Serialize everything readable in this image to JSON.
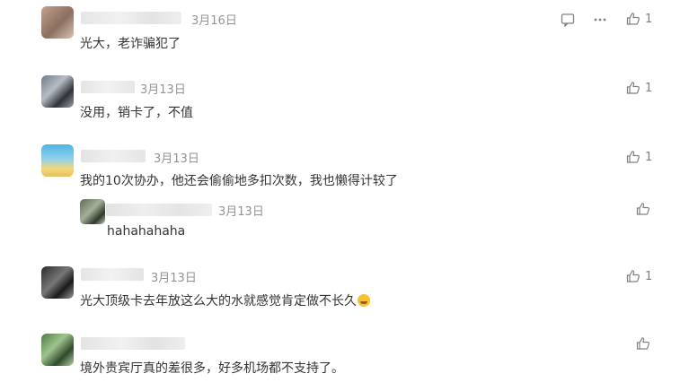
{
  "comments": [
    {
      "date": "3月16日",
      "text": "光大，老诈骗犯了",
      "likes": "1"
    },
    {
      "date": "3月13日",
      "text": "没用，销卡了，不值",
      "likes": "1"
    },
    {
      "date": "3月13日",
      "text": "我的10次协办，他还会偷偷地多扣次数，我也懒得计较了",
      "likes": "1"
    },
    {
      "date": "3月13日",
      "text": "hahahahaha",
      "likes": ""
    },
    {
      "date": "3月13日",
      "text": "光大顶级卡去年放这么大的水就感觉肯定做不长久",
      "likes": "1"
    },
    {
      "date": "",
      "text": "境外贵宾厅真的差很多，好多机场都不支持了。",
      "likes": ""
    }
  ],
  "icons": {
    "reply": "comment-icon",
    "more": "more-icon",
    "like": "thumbs-up-icon",
    "emoji": "facepalm-emoji"
  }
}
